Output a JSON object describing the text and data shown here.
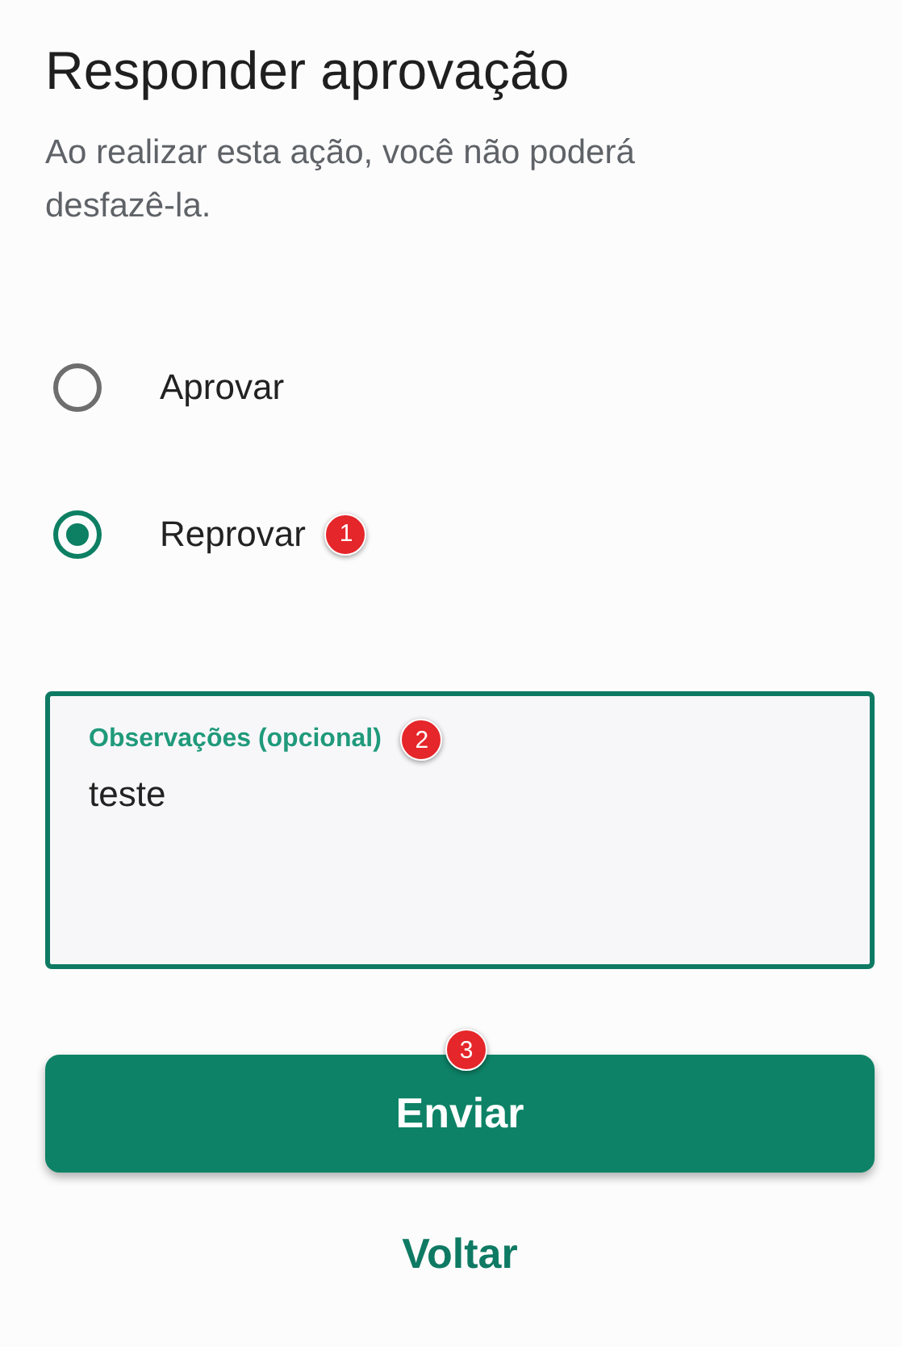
{
  "title": "Responder aprovação",
  "description": "Ao realizar esta ação, você não poderá desfazê-la.",
  "options": [
    {
      "label": "Aprovar",
      "selected": false
    },
    {
      "label": "Reprovar",
      "selected": true,
      "marker": "1"
    }
  ],
  "field": {
    "label": "Observações (opcional)",
    "value": "teste",
    "marker": "2"
  },
  "submit": {
    "label": "Enviar",
    "marker": "3"
  },
  "back": {
    "label": "Voltar"
  }
}
